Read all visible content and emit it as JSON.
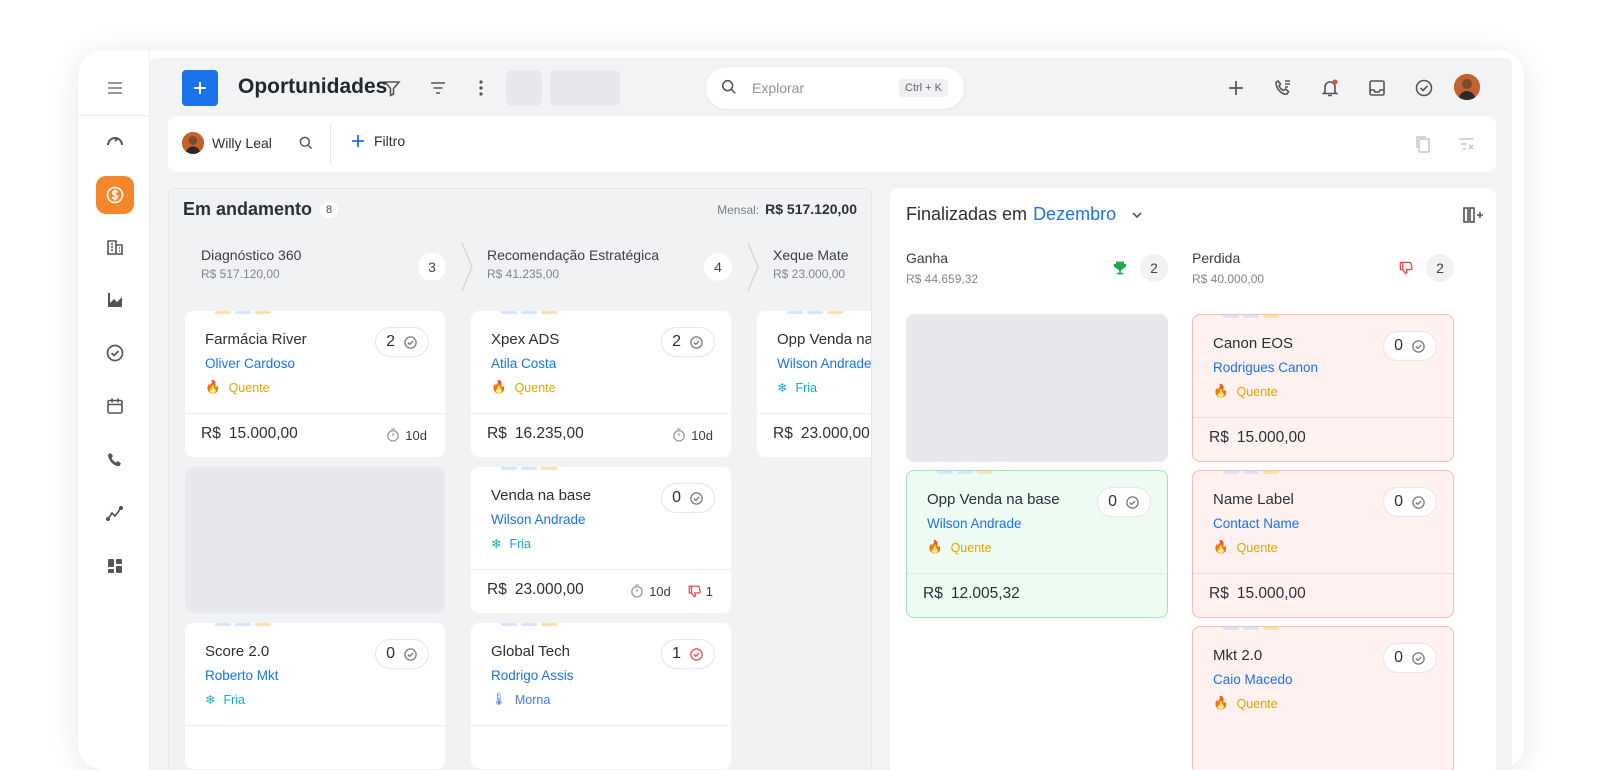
{
  "header": {
    "title": "Oportunidades",
    "search_placeholder": "Explorar",
    "search_shortcut": "Ctrl + K"
  },
  "filterbar": {
    "user_name": "Willy Leal",
    "filter_label": "Filtro"
  },
  "in_progress": {
    "title": "Em andamento",
    "count": "8",
    "monthly_label": "Mensal:",
    "monthly_value": "R$ 517.120,00",
    "columns": [
      {
        "name": "Diagnóstico 360",
        "value": "R$ 517.120,00",
        "count": "3"
      },
      {
        "name": "Recomendação Estratégica",
        "value": "R$ 41.235,00",
        "count": "4"
      },
      {
        "name": "Xeque Mate",
        "value": "R$ 23.000,00",
        "count": ""
      }
    ],
    "cards": [
      {
        "name": "Farmácia River",
        "contact": "Oliver Cardoso",
        "temp": "Quente",
        "count": "2",
        "currency": "R$",
        "amount": "15.000,00",
        "days": "10d"
      },
      {
        "name": "Score 2.0",
        "contact": "Roberto Mkt",
        "temp": "Fria",
        "count": "0"
      },
      {
        "name": "Xpex ADS",
        "contact": "Atila Costa",
        "temp": "Quente",
        "count": "2",
        "currency": "R$",
        "amount": "16.235,00",
        "days": "10d"
      },
      {
        "name": "Venda na base",
        "contact": "Wilson Andrade",
        "temp": "Fria",
        "count": "0",
        "currency": "R$",
        "amount": "23.000,00",
        "days": "10d",
        "dislikes": "1"
      },
      {
        "name": "Global Tech",
        "contact": "Rodrigo Assis",
        "temp": "Morna",
        "count": "1"
      },
      {
        "name": "Opp Venda na b",
        "contact": "Wilson Andrade",
        "temp": "Fria",
        "currency": "R$",
        "amount": "23.000,00"
      }
    ]
  },
  "finished": {
    "title_prefix": "Finalizadas em",
    "month": "Dezembro",
    "groups": [
      {
        "name": "Ganha",
        "value": "R$ 44.659,32",
        "count": "2"
      },
      {
        "name": "Perdida",
        "value": "R$ 40.000,00",
        "count": "2"
      }
    ],
    "cards": [
      {
        "name": "Opp Venda na base",
        "contact": "Wilson Andrade",
        "temp": "Quente",
        "count": "0",
        "currency": "R$",
        "amount": "12.005,32"
      },
      {
        "name": "Canon EOS",
        "contact": "Rodrigues Canon",
        "temp": "Quente",
        "count": "0",
        "currency": "R$",
        "amount": "15.000,00"
      },
      {
        "name": "Name Label",
        "contact": "Contact Name",
        "temp": "Quente",
        "count": "0",
        "currency": "R$",
        "amount": "15.000,00"
      },
      {
        "name": "Mkt 2.0",
        "contact": "Caio Macedo",
        "temp": "Quente",
        "count": "0"
      }
    ]
  },
  "colors": {
    "primary": "#1a73e8",
    "accent": "#f6862b",
    "won": "#9be3b6",
    "lost": "#f6b9b4"
  }
}
